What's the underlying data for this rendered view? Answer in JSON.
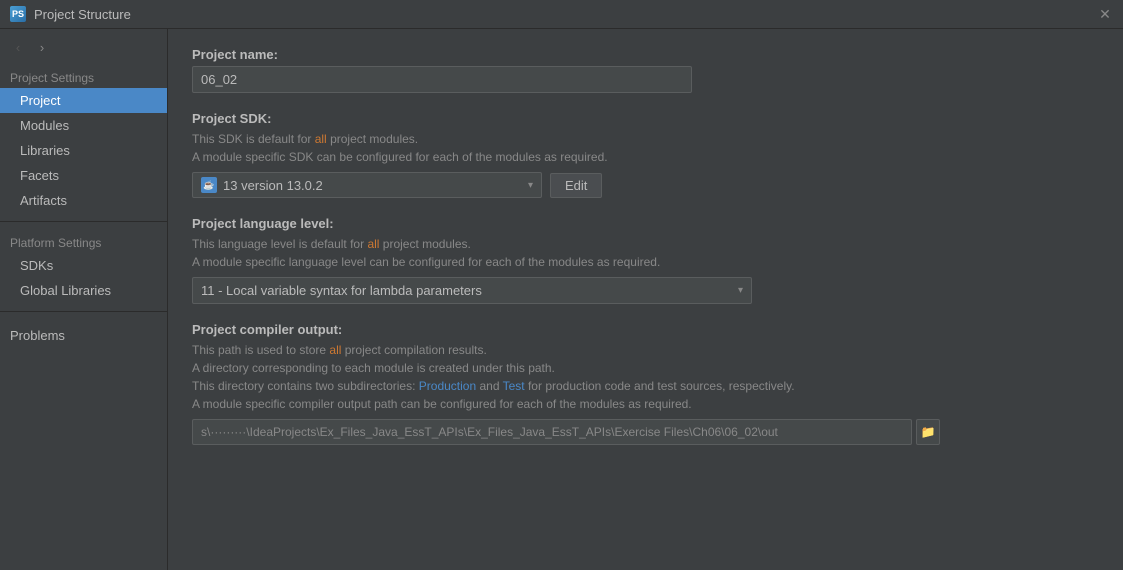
{
  "window": {
    "title": "Project Structure",
    "icon": "PS"
  },
  "nav": {
    "back_label": "←",
    "forward_label": "→"
  },
  "sidebar": {
    "project_settings_label": "Project Settings",
    "items": [
      {
        "id": "project",
        "label": "Project",
        "active": true
      },
      {
        "id": "modules",
        "label": "Modules",
        "active": false
      },
      {
        "id": "libraries",
        "label": "Libraries",
        "active": false
      },
      {
        "id": "facets",
        "label": "Facets",
        "active": false
      },
      {
        "id": "artifacts",
        "label": "Artifacts",
        "active": false
      }
    ],
    "platform_settings_label": "Platform Settings",
    "platform_items": [
      {
        "id": "sdks",
        "label": "SDKs",
        "active": false
      },
      {
        "id": "global-libraries",
        "label": "Global Libraries",
        "active": false
      }
    ],
    "problems_label": "Problems"
  },
  "main": {
    "project_name": {
      "label": "Project name:",
      "value": "06_02"
    },
    "project_sdk": {
      "label": "Project SDK:",
      "desc_line1": "This SDK is default for ",
      "desc_highlight1": "all",
      "desc_line1b": " project modules.",
      "desc_line2": "A module specific SDK can be configured for each of the modules as required.",
      "sdk_value": "13 version 13.0.2",
      "edit_label": "Edit"
    },
    "project_language_level": {
      "label": "Project language level:",
      "desc_line1": "This language level is default for ",
      "desc_highlight1": "all",
      "desc_line1b": " project modules.",
      "desc_line2": "A module specific language level can be configured for each of the modules as required.",
      "lang_value": "11 - Local variable syntax for lambda parameters"
    },
    "project_compiler_output": {
      "label": "Project compiler output:",
      "desc_line1": "This path is used to store ",
      "desc_highlight1": "all",
      "desc_line1b": " project compilation results.",
      "desc_line2": "A directory corresponding to each module is created under this path.",
      "desc_line3_pre": "This directory contains two subdirectories: ",
      "desc_production": "Production",
      "desc_line3_mid": " and ",
      "desc_test": "Test",
      "desc_line3b": " for production code and test sources, respectively.",
      "desc_line4": "A module specific compiler output path can be configured for each of the modules as required.",
      "output_path": "s\\·········\\IdeaProjects\\Ex_Files_Java_EssT_APIs\\Ex_Files_Java_EssT_APIs\\Exercise Files\\Ch06\\06_02\\out"
    }
  },
  "icons": {
    "close": "✕",
    "back": "‹",
    "forward": "›",
    "chevron_down": "▾",
    "folder": "📁",
    "sdk_icon": "☕"
  },
  "colors": {
    "highlight_orange": "#cc7832",
    "highlight_blue": "#4a88c7",
    "active_sidebar": "#4a88c7",
    "bg_dark": "#3c3f41",
    "bg_input": "#45494a"
  }
}
